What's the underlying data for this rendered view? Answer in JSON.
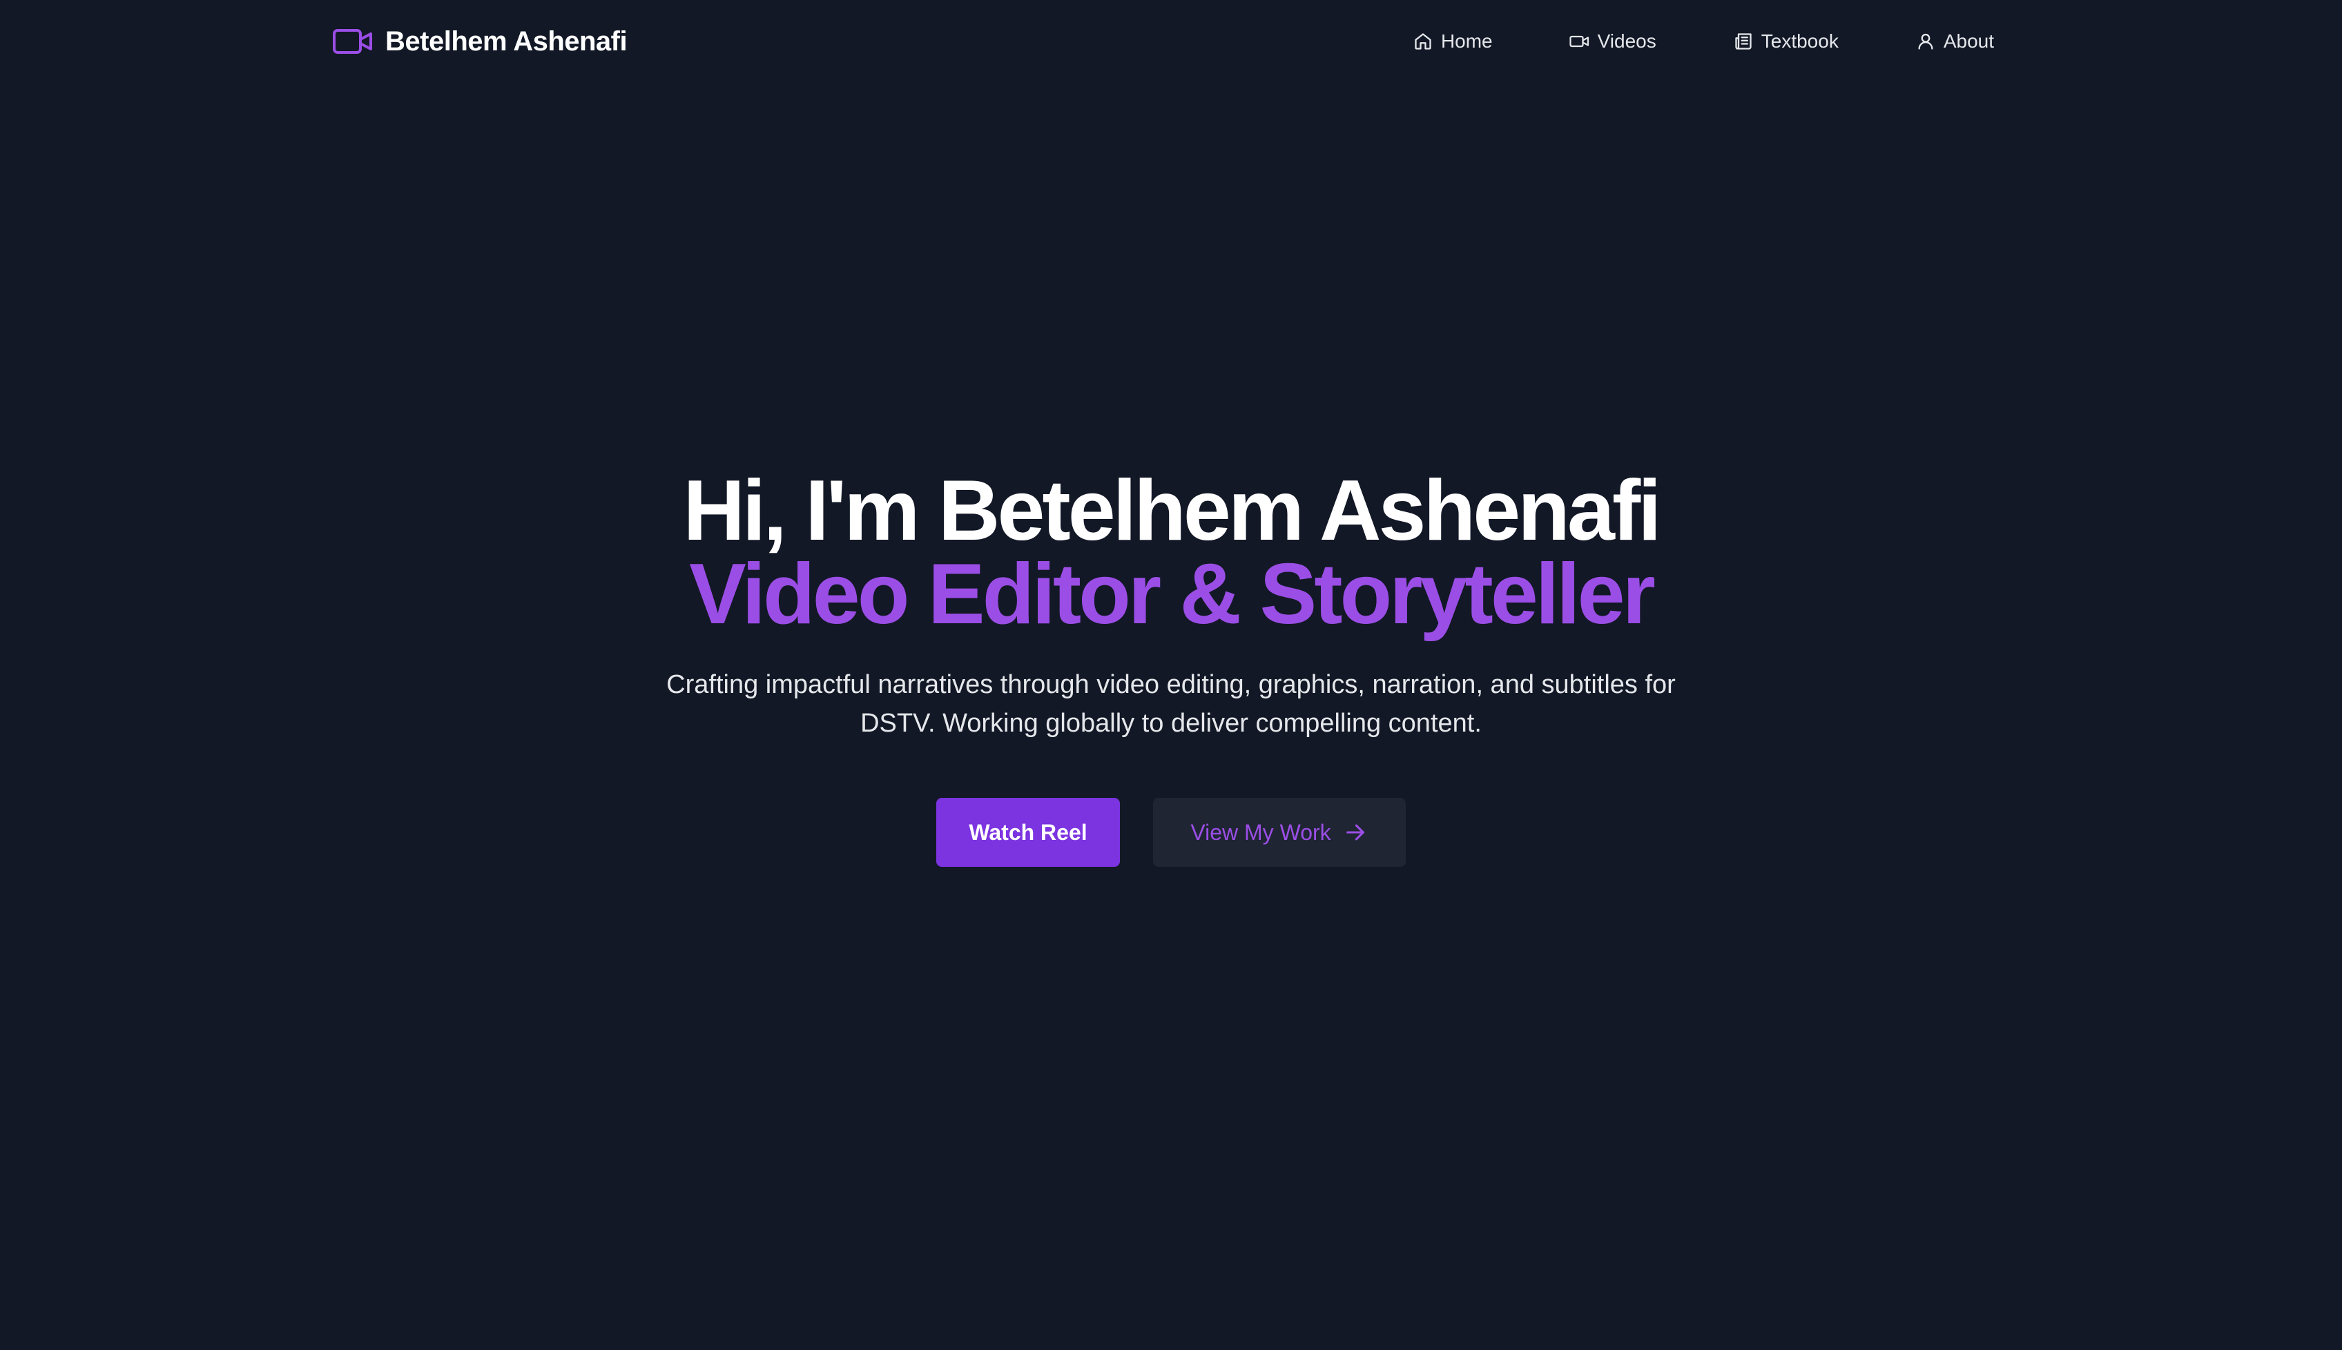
{
  "navbar": {
    "brand_name": "Betelhem Ashenafi",
    "brand_icon": "video-camera-icon",
    "links": [
      {
        "label": "Home",
        "icon": "home-icon"
      },
      {
        "label": "Videos",
        "icon": "video-icon"
      },
      {
        "label": "Textbook",
        "icon": "newspaper-icon"
      },
      {
        "label": "About",
        "icon": "user-icon"
      }
    ]
  },
  "hero": {
    "title": "Hi, I'm Betelhem Ashenafi",
    "subtitle": "Video Editor & Storyteller",
    "description": "Crafting impactful narratives through video editing, graphics, narration, and subtitles for DSTV. Working globally to deliver compelling content.",
    "primary_button": "Watch Reel",
    "secondary_button": "View My Work",
    "secondary_button_icon": "arrow-right-icon"
  },
  "colors": {
    "background": "#121826",
    "accent": "#9b4ee6",
    "button_primary": "#7c33e0",
    "button_secondary": "#1f2533",
    "text": "#ffffff"
  }
}
